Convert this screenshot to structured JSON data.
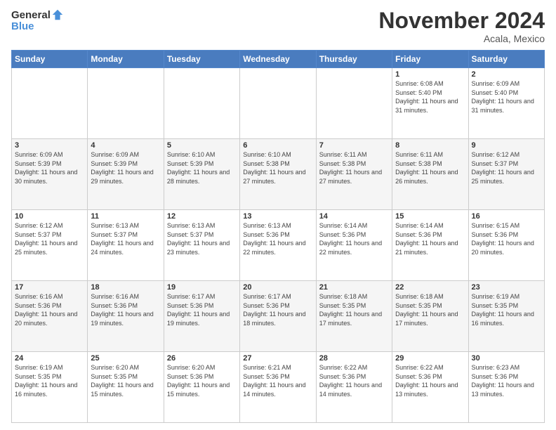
{
  "logo": {
    "general": "General",
    "blue": "Blue"
  },
  "title": "November 2024",
  "subtitle": "Acala, Mexico",
  "days_of_week": [
    "Sunday",
    "Monday",
    "Tuesday",
    "Wednesday",
    "Thursday",
    "Friday",
    "Saturday"
  ],
  "weeks": [
    [
      {
        "day": "",
        "info": ""
      },
      {
        "day": "",
        "info": ""
      },
      {
        "day": "",
        "info": ""
      },
      {
        "day": "",
        "info": ""
      },
      {
        "day": "",
        "info": ""
      },
      {
        "day": "1",
        "info": "Sunrise: 6:08 AM\nSunset: 5:40 PM\nDaylight: 11 hours and 31 minutes."
      },
      {
        "day": "2",
        "info": "Sunrise: 6:09 AM\nSunset: 5:40 PM\nDaylight: 11 hours and 31 minutes."
      }
    ],
    [
      {
        "day": "3",
        "info": "Sunrise: 6:09 AM\nSunset: 5:39 PM\nDaylight: 11 hours and 30 minutes."
      },
      {
        "day": "4",
        "info": "Sunrise: 6:09 AM\nSunset: 5:39 PM\nDaylight: 11 hours and 29 minutes."
      },
      {
        "day": "5",
        "info": "Sunrise: 6:10 AM\nSunset: 5:39 PM\nDaylight: 11 hours and 28 minutes."
      },
      {
        "day": "6",
        "info": "Sunrise: 6:10 AM\nSunset: 5:38 PM\nDaylight: 11 hours and 27 minutes."
      },
      {
        "day": "7",
        "info": "Sunrise: 6:11 AM\nSunset: 5:38 PM\nDaylight: 11 hours and 27 minutes."
      },
      {
        "day": "8",
        "info": "Sunrise: 6:11 AM\nSunset: 5:38 PM\nDaylight: 11 hours and 26 minutes."
      },
      {
        "day": "9",
        "info": "Sunrise: 6:12 AM\nSunset: 5:37 PM\nDaylight: 11 hours and 25 minutes."
      }
    ],
    [
      {
        "day": "10",
        "info": "Sunrise: 6:12 AM\nSunset: 5:37 PM\nDaylight: 11 hours and 25 minutes."
      },
      {
        "day": "11",
        "info": "Sunrise: 6:13 AM\nSunset: 5:37 PM\nDaylight: 11 hours and 24 minutes."
      },
      {
        "day": "12",
        "info": "Sunrise: 6:13 AM\nSunset: 5:37 PM\nDaylight: 11 hours and 23 minutes."
      },
      {
        "day": "13",
        "info": "Sunrise: 6:13 AM\nSunset: 5:36 PM\nDaylight: 11 hours and 22 minutes."
      },
      {
        "day": "14",
        "info": "Sunrise: 6:14 AM\nSunset: 5:36 PM\nDaylight: 11 hours and 22 minutes."
      },
      {
        "day": "15",
        "info": "Sunrise: 6:14 AM\nSunset: 5:36 PM\nDaylight: 11 hours and 21 minutes."
      },
      {
        "day": "16",
        "info": "Sunrise: 6:15 AM\nSunset: 5:36 PM\nDaylight: 11 hours and 20 minutes."
      }
    ],
    [
      {
        "day": "17",
        "info": "Sunrise: 6:16 AM\nSunset: 5:36 PM\nDaylight: 11 hours and 20 minutes."
      },
      {
        "day": "18",
        "info": "Sunrise: 6:16 AM\nSunset: 5:36 PM\nDaylight: 11 hours and 19 minutes."
      },
      {
        "day": "19",
        "info": "Sunrise: 6:17 AM\nSunset: 5:36 PM\nDaylight: 11 hours and 19 minutes."
      },
      {
        "day": "20",
        "info": "Sunrise: 6:17 AM\nSunset: 5:36 PM\nDaylight: 11 hours and 18 minutes."
      },
      {
        "day": "21",
        "info": "Sunrise: 6:18 AM\nSunset: 5:35 PM\nDaylight: 11 hours and 17 minutes."
      },
      {
        "day": "22",
        "info": "Sunrise: 6:18 AM\nSunset: 5:35 PM\nDaylight: 11 hours and 17 minutes."
      },
      {
        "day": "23",
        "info": "Sunrise: 6:19 AM\nSunset: 5:35 PM\nDaylight: 11 hours and 16 minutes."
      }
    ],
    [
      {
        "day": "24",
        "info": "Sunrise: 6:19 AM\nSunset: 5:35 PM\nDaylight: 11 hours and 16 minutes."
      },
      {
        "day": "25",
        "info": "Sunrise: 6:20 AM\nSunset: 5:35 PM\nDaylight: 11 hours and 15 minutes."
      },
      {
        "day": "26",
        "info": "Sunrise: 6:20 AM\nSunset: 5:36 PM\nDaylight: 11 hours and 15 minutes."
      },
      {
        "day": "27",
        "info": "Sunrise: 6:21 AM\nSunset: 5:36 PM\nDaylight: 11 hours and 14 minutes."
      },
      {
        "day": "28",
        "info": "Sunrise: 6:22 AM\nSunset: 5:36 PM\nDaylight: 11 hours and 14 minutes."
      },
      {
        "day": "29",
        "info": "Sunrise: 6:22 AM\nSunset: 5:36 PM\nDaylight: 11 hours and 13 minutes."
      },
      {
        "day": "30",
        "info": "Sunrise: 6:23 AM\nSunset: 5:36 PM\nDaylight: 11 hours and 13 minutes."
      }
    ]
  ]
}
